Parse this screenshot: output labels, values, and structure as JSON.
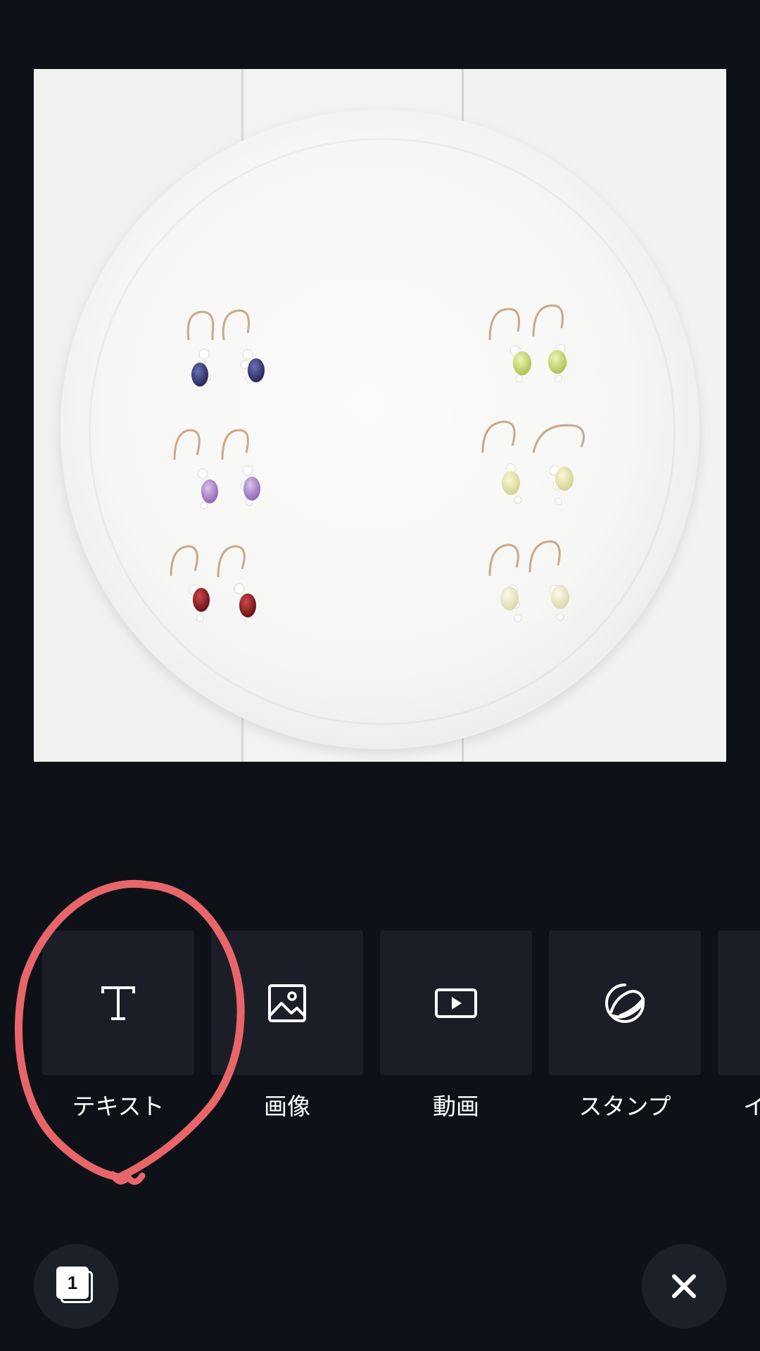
{
  "canvas": {
    "image_alt": "白いプレートの上に並んだピアス"
  },
  "toolbar": {
    "items": [
      {
        "label": "テキスト",
        "icon": "text-icon"
      },
      {
        "label": "画像",
        "icon": "image-icon"
      },
      {
        "label": "動画",
        "icon": "video-icon"
      },
      {
        "label": "スタンプ",
        "icon": "sticker-icon"
      },
      {
        "label": "イ",
        "icon": "more-icon"
      }
    ]
  },
  "bottom": {
    "page_count": "1",
    "close_icon": "close-icon"
  },
  "annotation": {
    "color": "#e8666a",
    "target": "テキスト"
  },
  "colors": {
    "background": "#0e1218",
    "tile": "#1b1e27",
    "text": "#ffffff"
  }
}
